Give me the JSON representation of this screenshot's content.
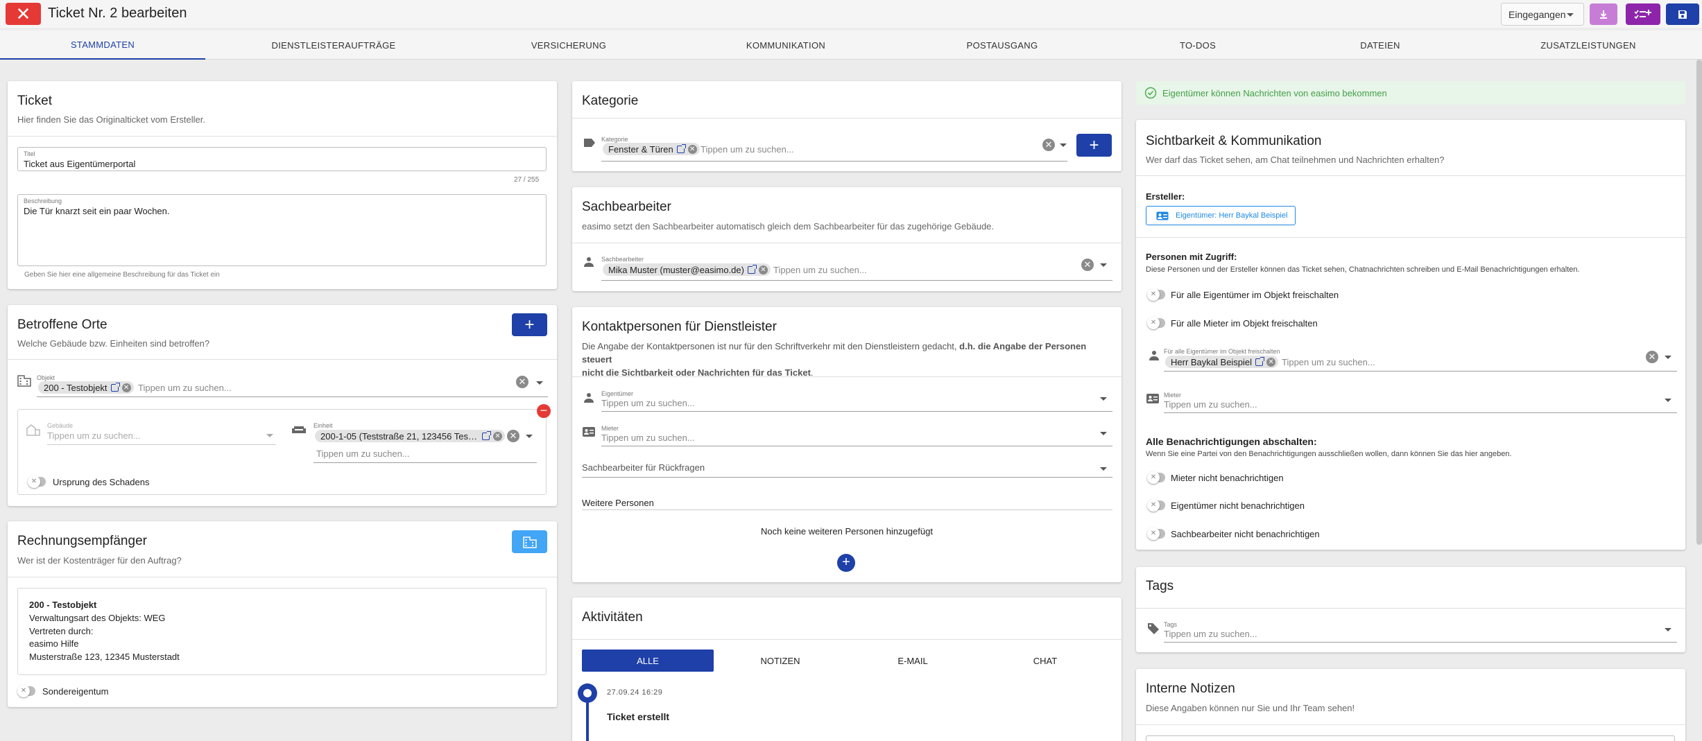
{
  "header": {
    "title": "Ticket Nr. 2 bearbeiten",
    "status": "Eingegangen"
  },
  "tabs": [
    "STAMMDATEN",
    "DIENSTLEISTERAUFTRÄGE",
    "VERSICHERUNG",
    "KOMMUNIKATION",
    "POSTAUSGANG",
    "TO-DOS",
    "DATEIEN",
    "ZUSATZLEISTUNGEN"
  ],
  "ticket": {
    "title": "Ticket",
    "subtitle": "Hier finden Sie das Originalticket vom Ersteller.",
    "titel_label": "Titel",
    "titel_value": "Ticket aus Eigentümerportal",
    "counter": "27 / 255",
    "desc_label": "Beschreibung",
    "desc_value": "Die Tür knarzt seit ein paar Wochen.",
    "desc_hint": "Geben Sie hier eine allgemeine Beschreibung für das Ticket ein"
  },
  "orte": {
    "title": "Betroffene Orte",
    "subtitle": "Welche Gebäude bzw. Einheiten sind betroffen?",
    "objekt_label": "Objekt",
    "objekt_chip": "200 - Testobjekt",
    "search_ph": "Tippen um zu suchen...",
    "gebaeude_label": "Gebäude",
    "einheit_label": "Einheit",
    "einheit_chip": "200-1-05 (Teststraße 21, 123456 Testst...",
    "ursprung": "Ursprung des Schadens"
  },
  "rechnung": {
    "title": "Rechnungsempfänger",
    "subtitle": "Wer ist der Kostenträger für den Auftrag?",
    "name": "200 - Testobjekt",
    "line1": "Verwaltungsart des Objekts: WEG",
    "line2": "Vertreten durch:",
    "line3": "easimo Hilfe",
    "line4": "Musterstraße 123, 12345 Musterstadt",
    "sonder": "Sondereigentum"
  },
  "kategorie": {
    "title": "Kategorie",
    "label": "Kategorie",
    "chip": "Fenster & Türen",
    "ph": "Tippen um zu suchen..."
  },
  "sachbearbeiter": {
    "title": "Sachbearbeiter",
    "subtitle": "easimo setzt den Sachbearbeiter automatisch gleich dem Sachbearbeiter für das zugehörige Gebäude.",
    "label": "Sachbearbeiter",
    "chip": "Mika Muster (muster@easimo.de)",
    "ph": "Tippen um zu suchen..."
  },
  "kontakt": {
    "title": "Kontaktpersonen für Dienstleister",
    "desc1": "Die Angabe der Kontaktpersonen ist nur für den Schriftverkehr mit den Dienstleistern gedacht, ",
    "desc_bold1": "d.h. die Angabe der Personen steuert",
    "desc_bold2": "nicht die Sichtbarkeit oder Nachrichten für das Ticket",
    "desc_end": ".",
    "eig_label": "Eigentümer",
    "mieter_label": "Mieter",
    "ph": "Tippen um zu suchen...",
    "rueck": "Sachbearbeiter für Rückfragen",
    "weitere": "Weitere Personen",
    "none": "Noch keine weiteren Personen hinzugefügt"
  },
  "aktivitaeten": {
    "title": "Aktivitäten",
    "tabs": [
      "ALLE",
      "NOTIZEN",
      "E-MAIL",
      "CHAT"
    ],
    "time": "27.09.24 16:29",
    "event": "Ticket erstellt"
  },
  "info": "Eigentümer können Nachrichten von easimo bekommen",
  "sicht": {
    "title": "Sichtbarkeit & Kommunikation",
    "subtitle": "Wer darf das Ticket sehen, am Chat teilnehmen und Nachrichten erhalten?",
    "ersteller_label": "Ersteller:",
    "ersteller_btn": "Eigentümer: Herr Baykal Beispiel",
    "zugriff_label": "Personen mit Zugriff:",
    "zugriff_desc": "Diese Personen und der Ersteller können das Ticket sehen, Chatnachrichten schreiben und E-Mail Benachrichtigungen erhalten.",
    "t1": "Für alle Eigentümer im Objekt freischalten",
    "t2": "Für alle Mieter im Objekt freischalten",
    "eig_field_label": "Für alle Eigentümer im Objekt freischalten",
    "eig_chip": "Herr Baykal Beispiel",
    "ph": "Tippen um zu suchen...",
    "mieter_label": "Mieter",
    "notif_label": "Alle Benachrichtigungen abschalten:",
    "notif_desc": "Wenn Sie eine Partei von den Benachrichtigungen ausschließen wollen, dann können Sie das hier angeben.",
    "n1": "Mieter nicht benachrichtigen",
    "n2": "Eigentümer nicht benachrichtigen",
    "n3": "Sachbearbeiter nicht benachrichtigen"
  },
  "tags": {
    "title": "Tags",
    "label": "Tags",
    "ph": "Tippen um zu suchen..."
  },
  "notizen": {
    "title": "Interne Notizen",
    "subtitle": "Diese Angaben können nur Sie und Ihr Team sehen!"
  },
  "colors": {
    "primary": "#1e40a8",
    "danger": "#e53935",
    "purple": "#8e24aa",
    "lightPurple": "#c77dd6",
    "success": "#4caf50"
  }
}
